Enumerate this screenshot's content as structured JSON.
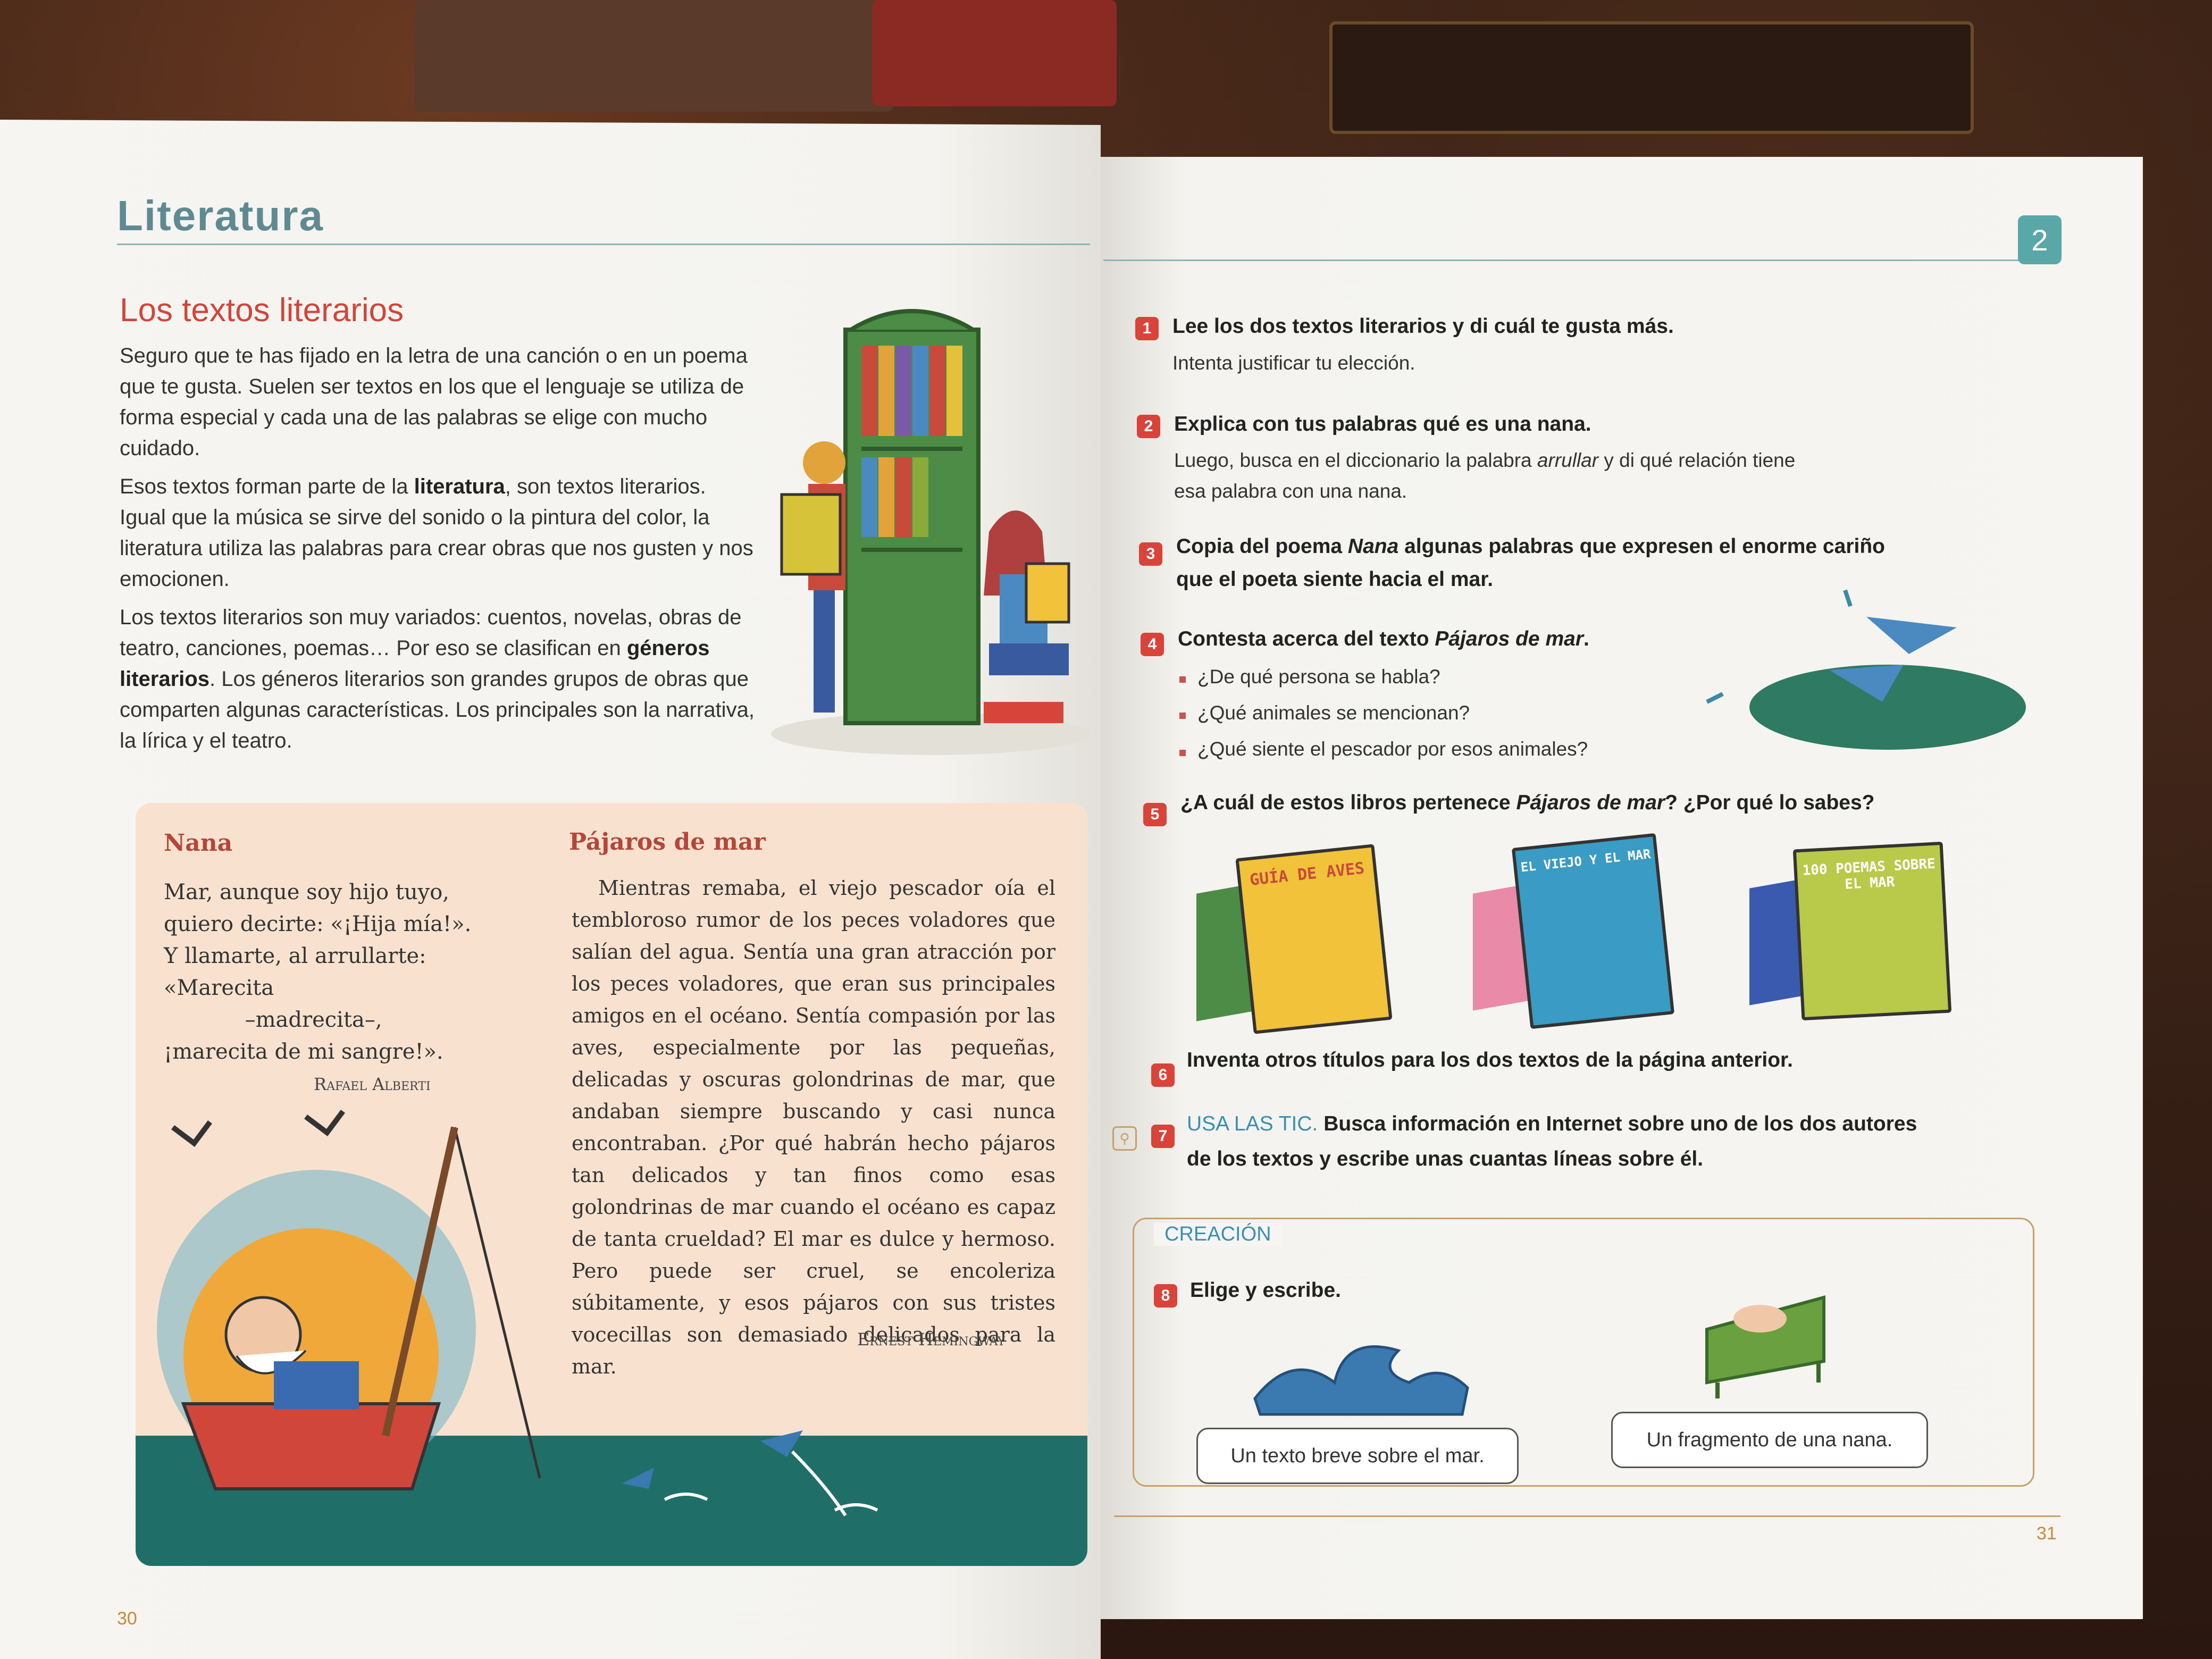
{
  "left_page": {
    "section": "Literatura",
    "heading": "Los textos literarios",
    "paragraph_1": "Seguro que te has fijado en la letra de una canción o en un poema que te gusta. Suelen ser textos en los que el lenguaje se utiliza de forma especial y cada una de las palabras se elige con mucho cuidado.",
    "paragraph_2_a": "Esos textos forman parte de la ",
    "paragraph_2_bold": "literatura",
    "paragraph_2_b": ", son textos literarios. Igual que la música se sirve del sonido o la pintura del color, la literatura utiliza las palabras para crear obras que nos gusten y nos emocionen.",
    "paragraph_3_a": "Los textos literarios son muy variados: cuentos, novelas, obras de teatro, canciones, poemas… Por eso se clasifican en ",
    "paragraph_3_bold": "géneros literarios",
    "paragraph_3_b": ". Los géneros literarios son grandes grupos de obras que comparten algunas características. Los principales son la narrativa, la lírica y el teatro.",
    "poem": {
      "title": "Nana",
      "lines": [
        "Mar, aunque soy hijo tuyo,",
        "quiero decirte: «¡Hija mía!».",
        "Y llamarte, al arrullarte:",
        "«Marecita",
        "            –madrecita–,",
        "¡marecita de mi sangre!»."
      ],
      "author": "Rafael Alberti"
    },
    "prose": {
      "title": "Pájaros de mar",
      "text": "Mientras remaba, el viejo pescador oía el tembloroso rumor de los peces voladores que salían del agua. Sentía una gran atracción por los peces voladores, que eran sus principales amigos en el océano. Sentía compasión por las aves, especialmente por las pequeñas, delicadas y oscuras golondrinas de mar, que andaban siempre buscando y casi nunca encontraban. ¿Por qué habrán hecho pájaros tan delicados y tan finos como esas golondrinas de mar cuando el océano es capaz de tanta crueldad? El mar es dulce y hermoso. Pero puede ser cruel, se encoleriza súbitamente, y esos pájaros con sus tristes vocecillas son demasiado delicados para la mar.",
      "author": "Ernest Hemingway"
    },
    "page_number": "30"
  },
  "right_page": {
    "unit_badge": "2",
    "exercises": [
      {
        "n": "1",
        "q": "Lee los dos textos literarios y di cuál te gusta más.",
        "sub": "Intenta justificar tu elección."
      },
      {
        "n": "2",
        "q": "Explica con tus palabras qué es una nana.",
        "sub_1": "Luego, busca en el diccionario la palabra ",
        "sub_italic": "arrullar",
        "sub_2": " y di qué relación tiene",
        "sub_line2": "esa palabra con una nana."
      },
      {
        "n": "3",
        "q_1": "Copia del poema ",
        "q_italic": "Nana",
        "q_2": " algunas palabras que expresen el enorme cariño",
        "q_line2": "que el poeta siente hacia el mar."
      },
      {
        "n": "4",
        "q_1": "Contesta acerca del texto ",
        "q_italic": "Pájaros de mar",
        "q_2": ".",
        "bullets": [
          "¿De qué persona se habla?",
          "¿Qué animales se mencionan?",
          "¿Qué siente el pescador por esos animales?"
        ]
      },
      {
        "n": "5",
        "q_1": "¿A cuál de estos libros pertenece ",
        "q_italic": "Pájaros de mar",
        "q_2": "? ¿Por qué lo sabes?"
      },
      {
        "n": "6",
        "q": "Inventa otros títulos para los dos textos de la página anterior."
      },
      {
        "n": "7",
        "tag": "USA LAS TIC.",
        "q": " Busca información en Internet sobre uno de los dos autores",
        "q_line2": "de los textos y escribe unas cuantas líneas sobre él."
      },
      {
        "n": "8",
        "q": "Elige y escribe."
      }
    ],
    "books": [
      {
        "title": "GUÍA DE AVES",
        "color": "#f2c23a"
      },
      {
        "title": "EL VIEJO Y EL MAR",
        "color": "#3a9bc4"
      },
      {
        "title": "100 POEMAS SOBRE EL MAR",
        "color": "#b9c94a"
      }
    ],
    "creacion_label": "CREACIÓN",
    "options": [
      "Un texto breve sobre el mar.",
      "Un fragmento de una nana."
    ],
    "page_number": "31"
  },
  "colors": {
    "accent_red": "#d9433a",
    "teal": "#5aa7a8",
    "heading_red": "#d0463b",
    "link_blue": "#3a8fb0"
  }
}
